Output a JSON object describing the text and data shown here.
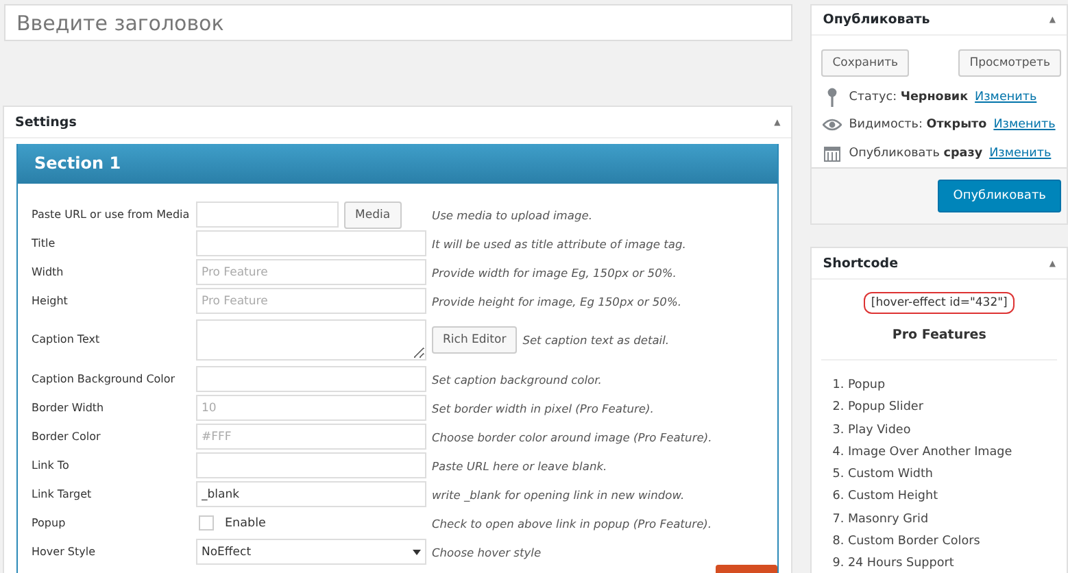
{
  "title_field": {
    "placeholder": "Введите заголовок"
  },
  "settings": {
    "title": "Settings",
    "collapse": "▲",
    "section_title": "Section 1",
    "rows": [
      {
        "kind": "media",
        "label": "Paste URL or use from Media",
        "button": "Media",
        "help": "Use media to upload image."
      },
      {
        "kind": "text",
        "label": "Title",
        "help": "It will be used as title attribute of image tag."
      },
      {
        "kind": "text",
        "label": "Width",
        "placeholder": "Pro Feature",
        "help": "Provide width for image Eg, 150px or 50%."
      },
      {
        "kind": "text",
        "label": "Height",
        "placeholder": "Pro Feature",
        "help": "Provide height for image, Eg 150px or 50%."
      },
      {
        "kind": "textarea",
        "label": "Caption Text",
        "button": "Rich Editor",
        "help": "Set caption text as detail."
      },
      {
        "kind": "text",
        "label": "Caption Background Color",
        "help": "Set caption background color."
      },
      {
        "kind": "text",
        "label": "Border Width",
        "placeholder": "10",
        "help": "Set border width in pixel (Pro Feature)."
      },
      {
        "kind": "text",
        "label": "Border Color",
        "placeholder": "#FFF",
        "help": "Choose border color around image (Pro Feature)."
      },
      {
        "kind": "text",
        "label": "Link To",
        "help": "Paste URL here or leave blank."
      },
      {
        "kind": "text",
        "label": "Link Target",
        "value": "_blank",
        "help": "write _blank for opening link in new window."
      },
      {
        "kind": "checkbox",
        "label": "Popup",
        "option": "Enable",
        "checked": false,
        "help": "Check to open above link in popup (Pro Feature)."
      },
      {
        "kind": "select",
        "label": "Hover Style",
        "value": "NoEffect",
        "help": "Choose hover style"
      }
    ]
  },
  "publish": {
    "title": "Опубликовать",
    "collapse": "▲",
    "save": "Сохранить",
    "preview": "Просмотреть",
    "meta": [
      {
        "kind": "status",
        "label": "Статус:",
        "value": "Черновик",
        "link": "Изменить"
      },
      {
        "kind": "visibility",
        "label": "Видимость:",
        "value": "Открыто",
        "link": "Изменить"
      },
      {
        "kind": "schedule",
        "label": "Опубликовать",
        "value": "сразу",
        "link": "Изменить"
      }
    ],
    "publish_button": "Опубликовать"
  },
  "shortcode": {
    "title": "Shortcode",
    "collapse": "▲",
    "code": "[hover-effect id=\"432\"]",
    "features_title": "Pro Features",
    "features": [
      "1. Popup",
      "2. Popup Slider",
      "3. Play Video",
      "4. Image Over Another Image",
      "5. Custom Width",
      "6. Custom Height",
      "7. Masonry Grid",
      "8. Custom Border Colors",
      "9. 24 Hours Support"
    ]
  }
}
